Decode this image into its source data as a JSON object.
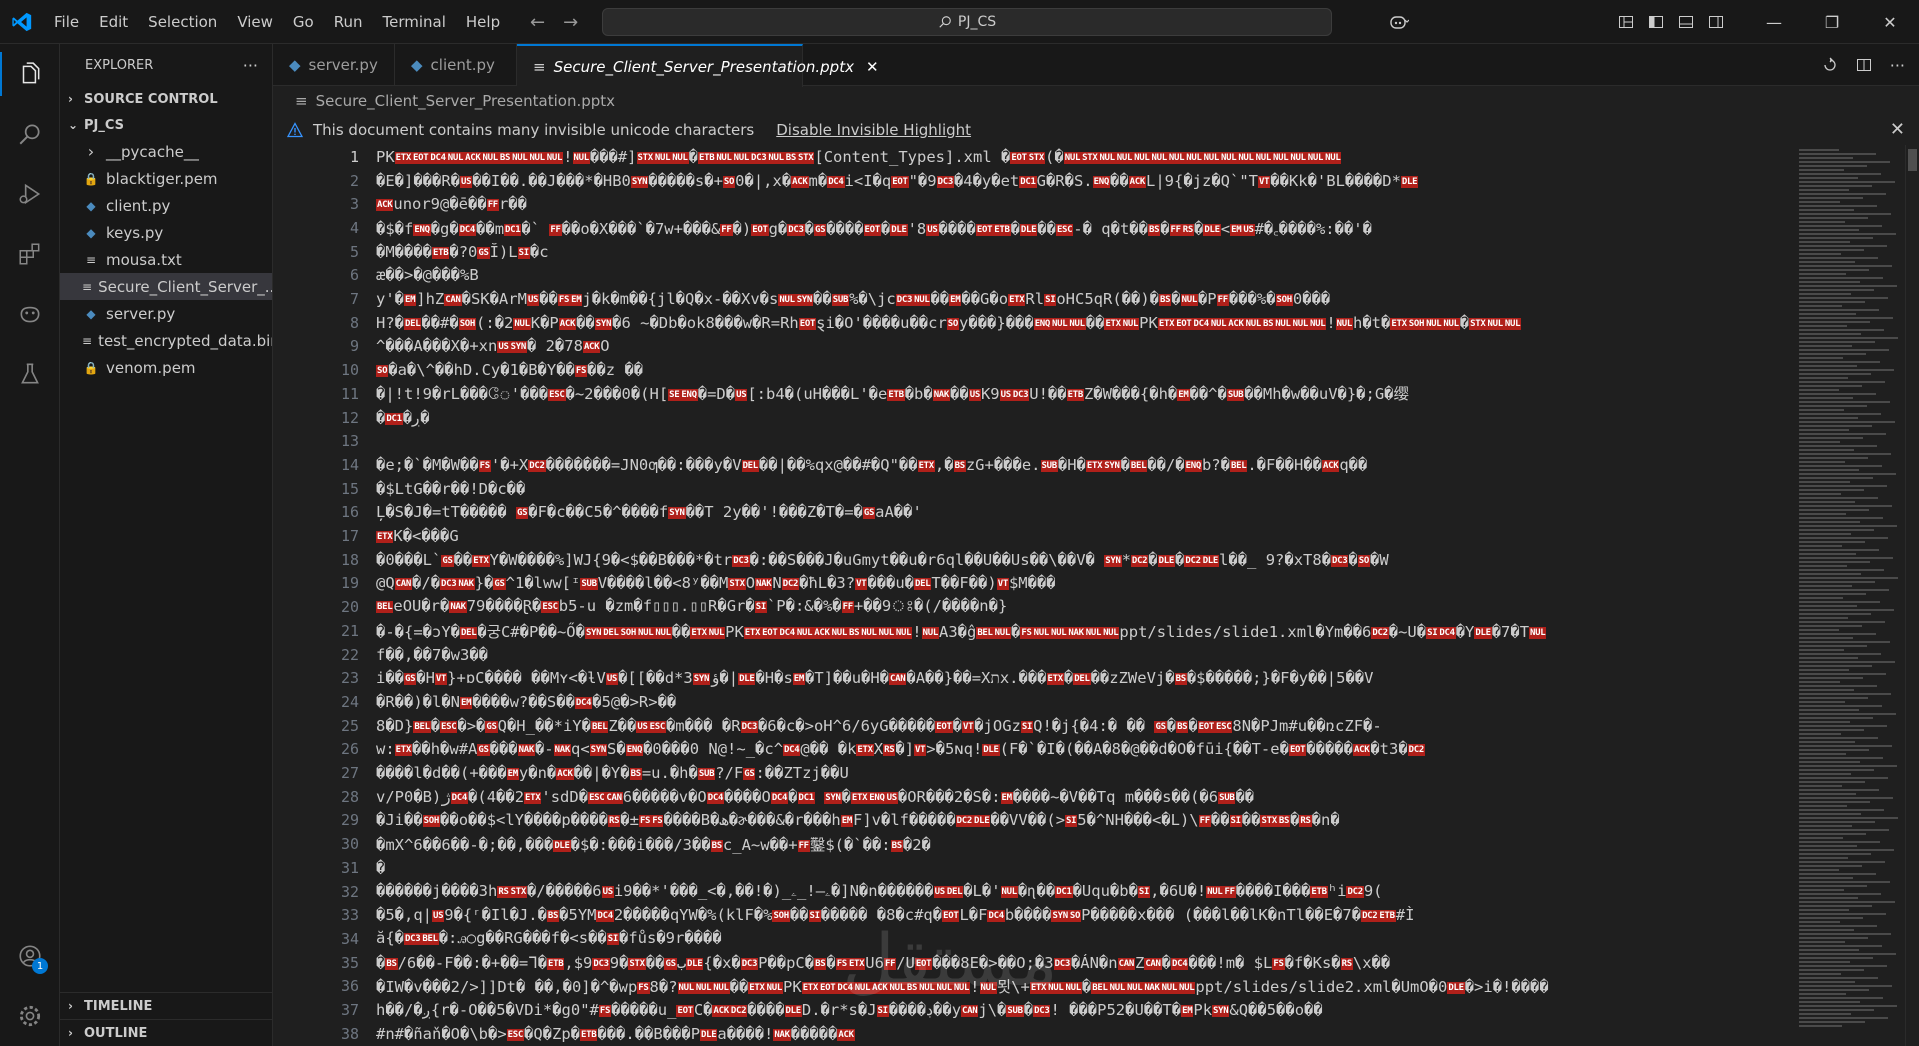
{
  "menu": [
    "File",
    "Edit",
    "Selection",
    "View",
    "Go",
    "Run",
    "Terminal",
    "Help"
  ],
  "search": {
    "text": "PJ_CS"
  },
  "sidebar": {
    "title": "EXPLORER",
    "more": "···",
    "source_control": "SOURCE CONTROL",
    "project": "PJ_CS",
    "files": [
      {
        "name": "__pycache__",
        "icon": "chevron-right-icon",
        "color": "#cccccc"
      },
      {
        "name": "blacktiger.pem",
        "icon": "lock-icon",
        "color": "#cba650"
      },
      {
        "name": "client.py",
        "icon": "python-icon",
        "color": "#4b8bbe"
      },
      {
        "name": "keys.py",
        "icon": "python-icon",
        "color": "#4b8bbe"
      },
      {
        "name": "mousa.txt",
        "icon": "text-file-icon",
        "color": "#cccccc"
      },
      {
        "name": "Secure_Client_Server_...",
        "icon": "text-file-icon",
        "color": "#cccccc"
      },
      {
        "name": "server.py",
        "icon": "python-icon",
        "color": "#4b8bbe"
      },
      {
        "name": "test_encrypted_data.bin",
        "icon": "text-file-icon",
        "color": "#cccccc"
      },
      {
        "name": "venom.pem",
        "icon": "lock-icon",
        "color": "#cba650"
      }
    ],
    "timeline": "TIMELINE",
    "outline": "OUTLINE"
  },
  "tabs": [
    {
      "label": "server.py",
      "icon": "python-icon"
    },
    {
      "label": "client.py",
      "icon": "python-icon"
    },
    {
      "label": "Secure_Client_Server_Presentation.pptx",
      "icon": "text-file-icon",
      "close": "✕"
    }
  ],
  "breadcrumb": "Secure_Client_Server_Presentation.pptx",
  "warning": {
    "text": "This document contains many invisible unicode characters",
    "link": "Disable Invisible Highlight",
    "close": "✕"
  },
  "account_badge": "1",
  "watermark": "مستقل",
  "colors": {
    "accent": "#0078d4",
    "control_char_bg": "#b0201a"
  },
  "editor": {
    "lines": [
      {
        "n": "1",
        "t": "PK[ETX][EOT][DC4][NUL][ACK][NUL][BS][NUL][NUL][NUL]![NUL]���#][STX][NUL][NUL]�[ETB][NUL][NUL][DC3][NUL][BS][STX][Content_Types].xml �[EOT][STX](�[NUL][STX][NUL][NUL][NUL][NUL][NUL][NUL][NUL][NUL][NUL][NUL][NUL][NUL][NUL][NUL]"
      },
      {
        "n": "2",
        "t": "�E�]���R�[US]��I��.��J���*�HB0[SYN]�����s�+[SO]0�|,x�[ACK]m�[DC4]i<I�q[EOT]\"�9[DC3]�4�y�et[DC1]G�R�S.[ENQ]��[ACK]L|9{�jz�Q`\"T[VT]��Kk�'BL����D*[DLE]"
      },
      {
        "n": "3",
        "t": "[ACK]unor9@�ē��[FF]r��"
      },
      {
        "n": "4",
        "t": "�$�f[ENQ]�g�[DC4]��m[DC1]�` [FF]��o�X���`�7w+���&[FF]�)[EOT]g�[DC3]�[GS]����[EOT]�[DLE]'8[US]����[EOT][ETB]�[DLE]��[ESC]-�   q�t��[BS]�[FF][RS]�[DLE]<[EM][US]#�꜀����%:��'�"
      },
      {
        "n": "5",
        "t": "�M����[ETB]�?0[GS]Ĭ)L[SI]�c"
      },
      {
        "n": "6",
        "t": "æ��>�@���%B"
      },
      {
        "n": "7",
        "t": "y'�[EM]]hZ[CAN]�SK�ArM[US]��[FS][EM]j�k�m��{jl�Q�x-��Xv�s[NUL][SYN]��[SUB]%�\\jc[DC3][NUL]��[EM]��G�o[ETX]Rl[SI]oHC5qR(��)�[BS]�[NUL]�P[FF]���%�[SOH]0���"
      },
      {
        "n": "8",
        "t": "H?�[DEL]��#�[SOH](:�2[NUL]K�P[ACK]��[SYN]�6 ~�Db�ok8���w�R=Rh[EOT]ȿi�O'����u��cr[SO]y���}���[ENQ][NUL][NUL]��[ETX][NUL]PK[ETX][EOT][DC4][NUL][ACK][NUL][BS][NUL][NUL][NUL]![NUL]h�t�[ETX][SOH][NUL][NUL]�[STX][NUL][NUL]"
      },
      {
        "n": "9",
        "t": "^���A���X�+xn[US][SYN]� 2�78[ACK]O"
      },
      {
        "n": "10",
        "t": "[SO]�a�\\^��hD.Cy�1�B�Y��[FS]��z ��"
      },
      {
        "n": "11",
        "t": "�|!t!9�rL���ே'���[ESC]�~2���0�(H[[SE][ENQ]�=D�[US][:b4�(uH���L'�e[ETB]�b�[NAK]��[US]K9[US][DC3]U!��[ETB]Z�W���{�h�[EM]��^�[SUB]��Mh�w��uV�}�;G�缨"
      },
      {
        "n": "12",
        "t": "�[DC1]�ڔ�"
      },
      {
        "n": "13",
        "t": ""
      },
      {
        "n": "14",
        "t": "�e;�`�M�W��[FS]'�+X[DC2]�������=JN0ƣ��:���y�V[DEL]��|��%qx@��#�Q\"��[ETX],�[BS]zG+���e.[SUB]�H�[ETX][SYN]�[BEL]��/�[ENQ]b?�[BEL].�F��H��[ACK]q��"
      },
      {
        "n": "15",
        "t": "�$LtG��r��!D�c��"
      },
      {
        "n": "16",
        "t": "Ļ�S�J�=tT�����  [GS]�F�c��C5�^����f[SYN]��T 2y��'!���Z�T�=�[GS]aA��'"
      },
      {
        "n": "17",
        "t": "[ETX]K�<���G"
      },
      {
        "n": "18",
        "t": "�0���L`[GS]��[ETX]Y�W����%]WJ{9�<$��B���*�tr[DC3]�:��S���J�uGmyt��u�r6ql��U��Us��\\��V� [SYN]*[DC2]�[DLE]�[DC2][DLE]l��_    9?�xT8�[DC3]�[SO]�W"
      },
      {
        "n": "19",
        "t": "@Q[CAN]�/�[DC3][NAK]}�[GS]^1�lww[ᶦ[SUB]V����l��<8ʸ��M[STX]O[NAK]N[DC2]�ħL�3?[VT]���u�[DEL]T��F��)[VT]$M���"
      },
      {
        "n": "20",
        "t": "[BEL]eOU�r�[NAK]79����Ɽ�[ESC]b5-u    �zm�f▯▯▯.▯▯R�Gr�[SI]`P�:&�%�[FF]+��9ঃ�(/����n�}"
      },
      {
        "n": "21",
        "t": "�-�{=�ɔY�[DEL]�궁C#�P��~Ő�[SYN][DEL][SOH][NUL][NUL]��[ETX][NUL]PK[ETX][EOT][DC4][NUL][ACK][NUL][BS][NUL][NUL][NUL]![NUL]A3�ĝ[BEL][NUL]�[FS][NUL][NUL][NAK][NUL][NUL]ppt/slides/slide1.xml�Ym��6[DC2]�~U�[SI][DC4]�Y[DLE]�7�T[NUL]"
      },
      {
        "n": "22",
        "t": "f��,��7�w3��"
      },
      {
        "n": "23",
        "t": "i��[GS]�H[VT]}+ɒC����  ��Mʏ<�ƚV[US]�[[��d*3[SYN]ؤ�|[DLE]�H�s[EM]�T]��u�H�[CAN]�A��}��=Xתx.���[ETX]�[DEL]��zZWeVj�[BS]�$�����;}�F�y��|5��V"
      },
      {
        "n": "24",
        "t": "�R��)�l�N[EM]����w?��S��[DC4]�5@�>R>��"
      },
      {
        "n": "25",
        "t": "8�D}[BEL]�[ESC]�>�[GS]Q�H_��*iY�[BEL]Z��[US][ESC]�m���    �R[DC3]�6�c�>oH^6/6yG�����[EOT]�[VT]�jOGz[SI]Q!�j{�4:�   ��  [GS]�[BS]�[EOT][ESC]8N�PJm#u��ռcZF�-"
      },
      {
        "n": "26",
        "t": "w:[ETX]��h�w#A[GS]���[NAK]�-[NAK]q<[SYN]S�[ENQ]�0���0 N@!~_�c^[DC4]@��   �k[ETX]X[RS]�][VT]>�5ɴq![DLE](F�`�I�(��A�8�@��d�O�fūi{��T-e�[EOT]�����[ACK]�t3�[DC2]"
      },
      {
        "n": "27",
        "t": "����l�d��(+���[EM]y�n�[ACK]��|�Y�[BS]=u.�h�[SUB]?/F[GS]:��ZTzj��U"
      },
      {
        "n": "28",
        "t": "v/P0�B)ژ[DC4]�(4��2[ETX]'sdD�[ESC][CAN]6�����v�O[DC4]����O[DC4]�[DC1] [SYN]�[ETX][ENQ][US]�OR���2�S�:[EM]����~�V��Tq m���s��(�6[SUB]��"
      },
      {
        "n": "29",
        "t": "�Ji��[SOH]��o��$<lY����p����[RS]�±[FS][FS]����B�ھ�ɚ���&�r���h[EM]F]v�lf�����[DC2][DLE]��VV��(>[SI]5�^NH���<�L)\\[FF]��[SI]��[STX][BS]�[RS]�n�"
      },
      {
        "n": "30",
        "t": "�mX^6��6��-�;��,���[DLE]�$�:���i���/3��[BS]c_A~w��+[FF]鑿$(�`��:[BS]�2�"
      },
      {
        "n": "31",
        "t": "�"
      },
      {
        "n": "32",
        "t": "������j����3h[RS][STX]�/�����6[US]i9��*'���_<�,��!�)_ۦ—!_ۦ�]N�n������[US][DEL]�L�'[NUL]�ɳ��[DC1]�Uqu�b�[SI],�6U�![NUL][FF]����I���[ETB]ʰi[DC2]9("
      },
      {
        "n": "33",
        "t": "�5�,q|[US]9�{ʳ�Il�J.�[BS]�5YM[DC4]2�����qYW�%(klF�%[SOH]��[SI]�����  �8�c#q�[EOT]L�F[DC4]b����[SYN][SO]P�����x���  (���l��lK�nTl��E�7�[DC2][ETB]#Ì"
      },
      {
        "n": "34",
        "t": "ă{�[DC3][BEL]�:ꭿ○g��RG���f�<s��[SI]�fůs�9r����"
      },
      {
        "n": "35",
        "t": "�[BS]/6��-F��:�+��=ᒣ�[ETB],$9[DC3]9�[STX]��[GS]ب[DLE]{�x�[DC3]P��pC�[BS]�[FS][ETX]U6[FF]/U[EOT]���8E�>��O;�3[DC3]�ÁN�n[CAN]Z[CAN]�[DC4]���!m�   $L[FS]�f�Ks�[RS]\\x��"
      },
      {
        "n": "36",
        "t": "�IW�v���2/>]]Dt� ��,�0]�^�wp[FS]8�?[NUL][NUL][NUL]��[ETX][NUL]PK[ETX][EOT][DC4][NUL][ACK][NUL][BS][NUL][NUL][NUL]![NUL]묏\\+[ETX][NUL][NUL]�[BEL][NUL][NUL][NAK][NUL][NUL]ppt/slides/slide2.xml�UmO�0[DLE]�>i�!����"
      },
      {
        "n": "37",
        "t": "h��/�ږ{r�-O��5�VDi*�g0\"#[FS]�����u_[EOT]C�[ACK][DC2]����[DLE]D.�r*s�J[SI]����ڊ��y[CAN]j\\�[SUB]�[DC3]!    ���P52�U��T�[EM]Pk[SYN]&Q��5��o��"
      },
      {
        "n": "38",
        "t": "#n#�ñaň�O�\\b�>[ESC]�Q�Zp�[ETB]���.��B���P[DLE]a����![NAK]�����[ACK]"
      }
    ]
  }
}
